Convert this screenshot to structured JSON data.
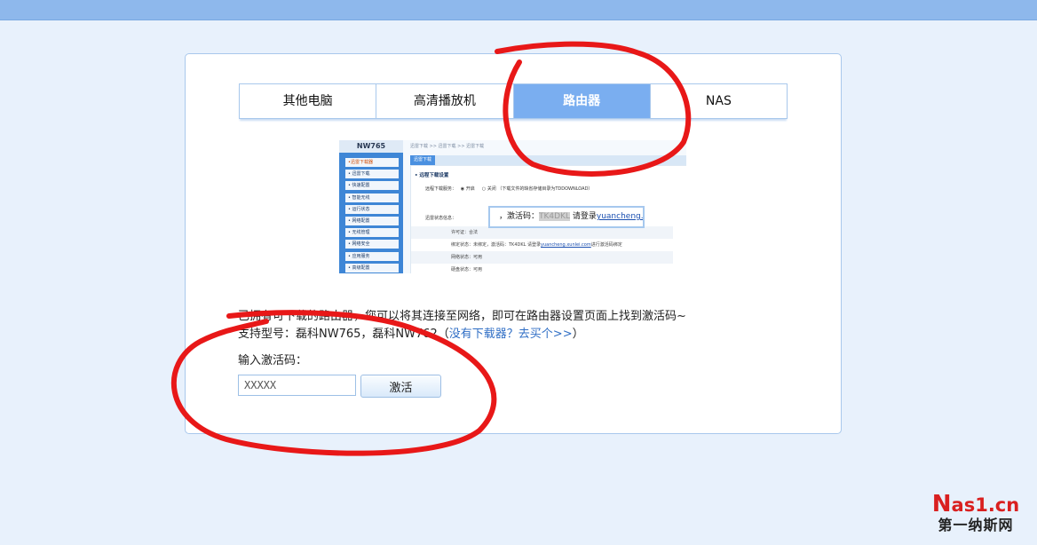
{
  "tabs": [
    {
      "label": "其他电脑",
      "active": false
    },
    {
      "label": "高清播放机",
      "active": false
    },
    {
      "label": "路由器",
      "active": true
    },
    {
      "label": "NAS",
      "active": false
    }
  ],
  "router_screenshot": {
    "model": "NW765",
    "menu": [
      "•迅雷下载器",
      "• 迅雷下载",
      "• 快速配置",
      "• 智能无线",
      "• 运行状态",
      "• 网络配置",
      "• 无线管理",
      "• 网络安全",
      "• 应用服务",
      "• 高级配置"
    ],
    "breadcrumb": "迅雷下载 >> 迅雷下载 >> 迅雷下载",
    "tab_label": "迅雷下载",
    "section_title": "• 远程下载设置",
    "remote_label": "远程下载服务：",
    "remote_on": "开启",
    "remote_off": "关闭",
    "remote_note": "（下载文件的缺省存储目录为TDDOWNLOAD）",
    "status_label": "迅雷状态信息：",
    "rows": [
      {
        "label": "许可证：合法"
      },
      {
        "label": "绑定状态：未绑定，激活码：TK4DKL  请登录",
        "link": "yuancheng.xunlei.com",
        "tail": "进行激活码绑定"
      },
      {
        "label": "网络状态：可用"
      },
      {
        "label": "硬盘状态：可用"
      }
    ],
    "popup_prefix": "，激活码：",
    "popup_code": "TK4DKL",
    "popup_mid": " 请登录",
    "popup_link": "yuancheng.xunlei."
  },
  "info_line1": "已拥有可下载的路由器，您可以将其连接至网络，即可在路由器设置页面上找到激活码~",
  "info_line2_prefix": "支持型号：磊科NW765，磊科NW762（",
  "info_line2_link": "没有下载器？去买个>>",
  "info_line2_suffix": "）",
  "input_label": "输入激活码：",
  "code_input": {
    "value": "",
    "placeholder": "XXXXX"
  },
  "activate_label": "激活",
  "watermark": {
    "top_n": "N",
    "top_rest": "as1.cn",
    "bottom": "第一纳斯网"
  },
  "colors": {
    "accent": "#7aaef0",
    "annotation": "#e81818",
    "watermark_red": "#d92020"
  }
}
